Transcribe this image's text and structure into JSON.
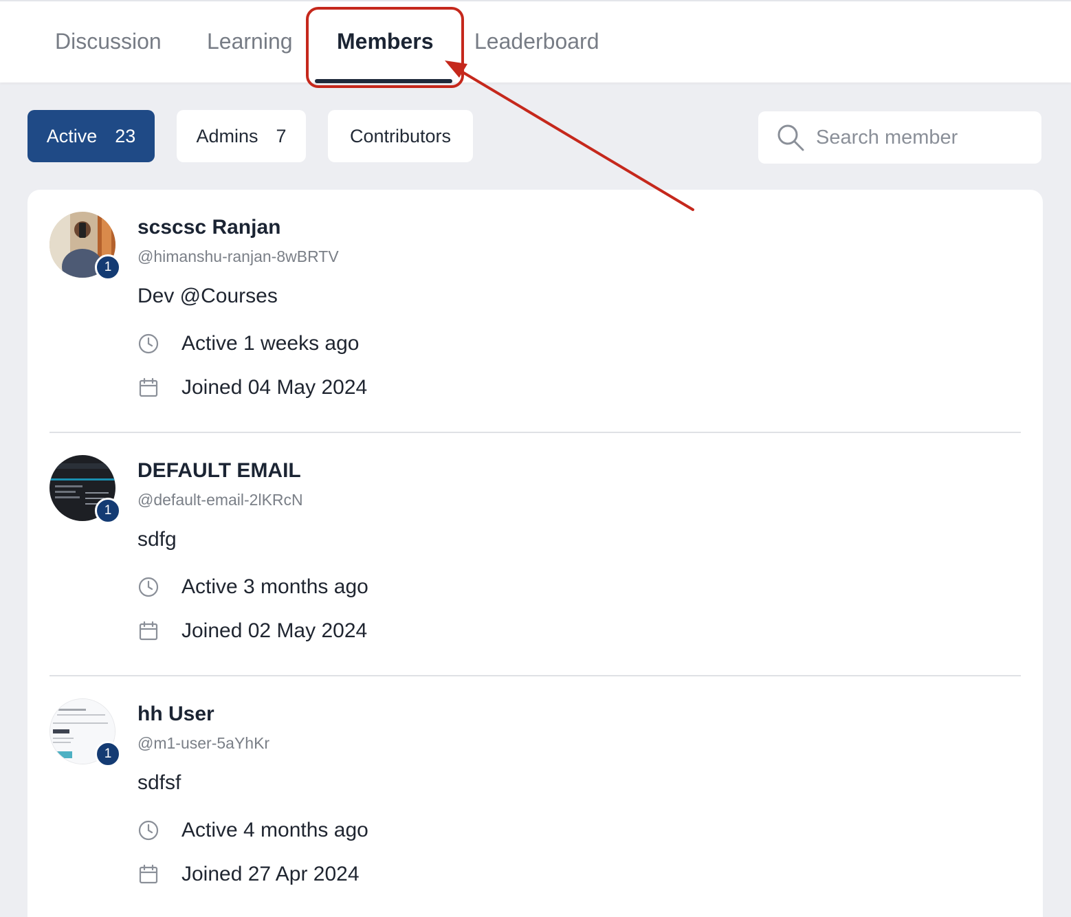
{
  "tabs": [
    {
      "label": "Discussion",
      "active": false
    },
    {
      "label": "Learning",
      "active": false
    },
    {
      "label": "Members",
      "active": true
    },
    {
      "label": "Leaderboard",
      "active": false
    }
  ],
  "filters": {
    "active": {
      "label": "Active",
      "count": "23"
    },
    "admins": {
      "label": "Admins",
      "count": "7"
    },
    "contributors": {
      "label": "Contributors"
    }
  },
  "search": {
    "placeholder": "Search member"
  },
  "members": [
    {
      "name": "scscsc Ranjan",
      "handle": "@himanshu-ranjan-8wBRTV",
      "bio": "Dev @Courses",
      "active": "Active 1 weeks ago",
      "joined": "Joined 04 May 2024",
      "badge": "1"
    },
    {
      "name": "DEFAULT EMAIL",
      "handle": "@default-email-2lKRcN",
      "bio": "sdfg",
      "active": "Active 3 months ago",
      "joined": "Joined 02 May 2024",
      "badge": "1"
    },
    {
      "name": "hh User",
      "handle": "@m1-user-5aYhKr",
      "bio": "sdfsf",
      "active": "Active 4 months ago",
      "joined": "Joined 27 Apr 2024",
      "badge": "1"
    }
  ],
  "colors": {
    "accent": "#1f4a86",
    "badge": "#143b73",
    "annotation": "#c5281c",
    "background": "#edeef2"
  },
  "icons": [
    "search-icon",
    "clock-icon",
    "calendar-icon",
    "arrow-annotation"
  ]
}
